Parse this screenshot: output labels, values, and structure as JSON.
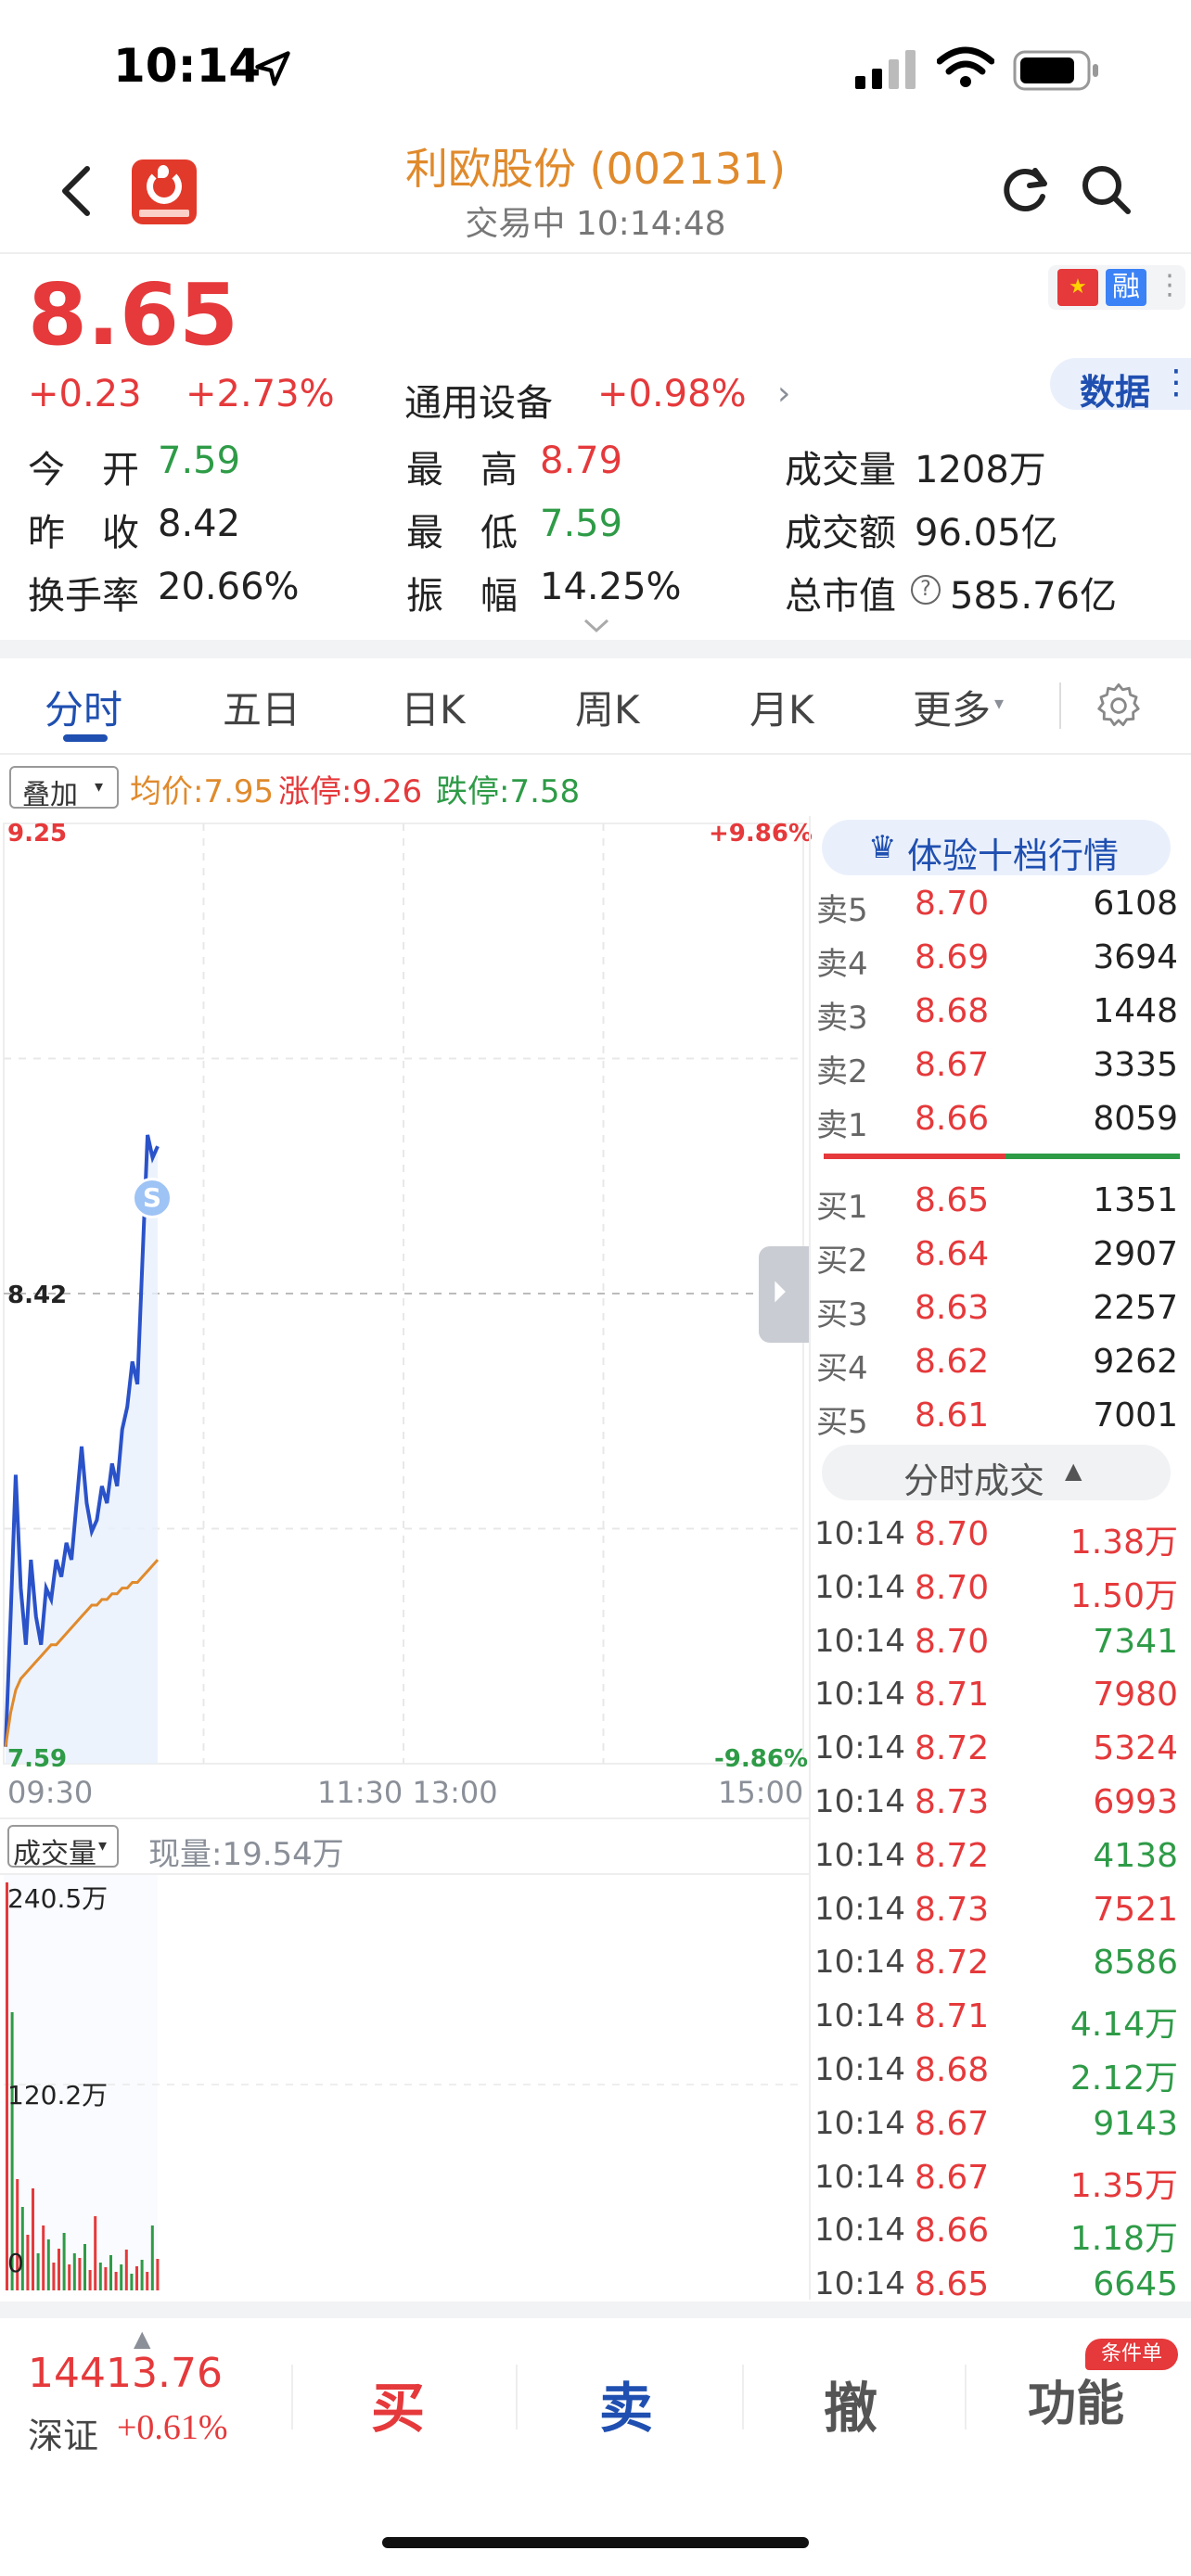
{
  "status_bar": {
    "time": "10:14"
  },
  "header": {
    "title": "利欧股份 (002131)",
    "subtitle": "交易中 10:14:48"
  },
  "quote": {
    "price": "8.65",
    "change": "+0.23",
    "change_pct": "+2.73%",
    "sector_name": "通用设备",
    "sector_change": "+0.98%",
    "badge_rong": "融",
    "data_button": "数据",
    "stats": [
      {
        "label": "今　开",
        "value": "7.59",
        "color": "green"
      },
      {
        "label": "最　高",
        "value": "8.79",
        "color": "red"
      },
      {
        "label": "成交量",
        "value": "1208万",
        "color": "plain"
      },
      {
        "label": "昨　收",
        "value": "8.42",
        "color": "plain"
      },
      {
        "label": "最　低",
        "value": "7.59",
        "color": "green"
      },
      {
        "label": "成交额",
        "value": "96.05亿",
        "color": "plain"
      },
      {
        "label": "换手率",
        "value": "20.66%",
        "color": "plain"
      },
      {
        "label": "振　幅",
        "value": "14.25%",
        "color": "plain"
      },
      {
        "label": "总市值",
        "value": "585.76亿",
        "color": "plain"
      }
    ]
  },
  "tabs": [
    {
      "label": "分时",
      "active": true
    },
    {
      "label": "五日",
      "active": false
    },
    {
      "label": "日K",
      "active": false
    },
    {
      "label": "周K",
      "active": false
    },
    {
      "label": "月K",
      "active": false
    },
    {
      "label": "更多",
      "active": false
    }
  ],
  "overlay": {
    "button": "叠加",
    "avg_price": "均价:7.95",
    "limit_up": "涨停:9.26",
    "limit_down": "跌停:7.58"
  },
  "chart": {
    "y_top": "9.25",
    "y_mid": "8.42",
    "y_bottom": "7.59",
    "pct_top": "+9.86%",
    "pct_bottom": "-9.86%",
    "x_labels": {
      "start": "09:30",
      "mid": "11:30 13:00",
      "end": "15:00"
    },
    "marker": "S"
  },
  "volume": {
    "button": "成交量",
    "current": "现量:19.54万",
    "y_top": "240.5万",
    "y_mid": "120.2万",
    "y_zero": "0"
  },
  "chart_data": {
    "type": "line",
    "title": "",
    "ylim": [
      7.59,
      9.25
    ],
    "reference": 8.42,
    "series": [
      {
        "name": "价格",
        "values": [
          7.62,
          7.85,
          8.1,
          7.9,
          7.8,
          7.95,
          7.85,
          7.8,
          7.9,
          7.88,
          7.95,
          7.92,
          7.98,
          7.95,
          8.05,
          8.15,
          8.05,
          8.0,
          8.02,
          8.08,
          8.05,
          8.12,
          8.08,
          8.18,
          8.22,
          8.3,
          8.26,
          8.48,
          8.7,
          8.66,
          8.68
        ]
      },
      {
        "name": "均价",
        "values": [
          7.62,
          7.68,
          7.72,
          7.74,
          7.75,
          7.76,
          7.77,
          7.78,
          7.79,
          7.8,
          7.8,
          7.81,
          7.82,
          7.83,
          7.84,
          7.85,
          7.86,
          7.87,
          7.87,
          7.88,
          7.88,
          7.89,
          7.89,
          7.9,
          7.9,
          7.91,
          7.91,
          7.92,
          7.93,
          7.94,
          7.95
        ]
      }
    ]
  },
  "order_book": {
    "title": "体验十档行情",
    "asks": [
      {
        "label": "卖5",
        "price": "8.70",
        "qty": "6108"
      },
      {
        "label": "卖4",
        "price": "8.69",
        "qty": "3694"
      },
      {
        "label": "卖3",
        "price": "8.68",
        "qty": "1448"
      },
      {
        "label": "卖2",
        "price": "8.67",
        "qty": "3335"
      },
      {
        "label": "卖1",
        "price": "8.66",
        "qty": "8059"
      }
    ],
    "bids": [
      {
        "label": "买1",
        "price": "8.65",
        "qty": "1351"
      },
      {
        "label": "买2",
        "price": "8.64",
        "qty": "2907"
      },
      {
        "label": "买3",
        "price": "8.63",
        "qty": "2257"
      },
      {
        "label": "买4",
        "price": "8.62",
        "qty": "9262"
      },
      {
        "label": "买5",
        "price": "8.61",
        "qty": "7001"
      }
    ],
    "trades_title": "分时成交",
    "trades": [
      {
        "time": "10:14",
        "price": "8.70",
        "vol": "1.38万",
        "side": "red"
      },
      {
        "time": "10:14",
        "price": "8.70",
        "vol": "1.50万",
        "side": "red"
      },
      {
        "time": "10:14",
        "price": "8.70",
        "vol": "7341",
        "side": "green"
      },
      {
        "time": "10:14",
        "price": "8.71",
        "vol": "7980",
        "side": "red"
      },
      {
        "time": "10:14",
        "price": "8.72",
        "vol": "5324",
        "side": "red"
      },
      {
        "time": "10:14",
        "price": "8.73",
        "vol": "6993",
        "side": "red"
      },
      {
        "time": "10:14",
        "price": "8.72",
        "vol": "4138",
        "side": "green"
      },
      {
        "time": "10:14",
        "price": "8.73",
        "vol": "7521",
        "side": "red"
      },
      {
        "time": "10:14",
        "price": "8.72",
        "vol": "8586",
        "side": "green"
      },
      {
        "time": "10:14",
        "price": "8.71",
        "vol": "4.14万",
        "side": "green"
      },
      {
        "time": "10:14",
        "price": "8.68",
        "vol": "2.12万",
        "side": "green"
      },
      {
        "time": "10:14",
        "price": "8.67",
        "vol": "9143",
        "side": "green"
      },
      {
        "time": "10:14",
        "price": "8.67",
        "vol": "1.35万",
        "side": "red"
      },
      {
        "time": "10:14",
        "price": "8.66",
        "vol": "1.18万",
        "side": "green"
      },
      {
        "time": "10:14",
        "price": "8.65",
        "vol": "6645",
        "side": "green"
      }
    ]
  },
  "bottom_bar": {
    "index_value": "14413.76",
    "index_name": "深证",
    "index_change": "+0.61%",
    "buy": "买",
    "sell": "卖",
    "cancel": "撤",
    "func": "功能",
    "func_badge": "条件单"
  },
  "colors": {
    "up": "#e5393b",
    "down": "#2e9b47",
    "accent": "#1f4fb0",
    "title": "#e08a2c"
  }
}
